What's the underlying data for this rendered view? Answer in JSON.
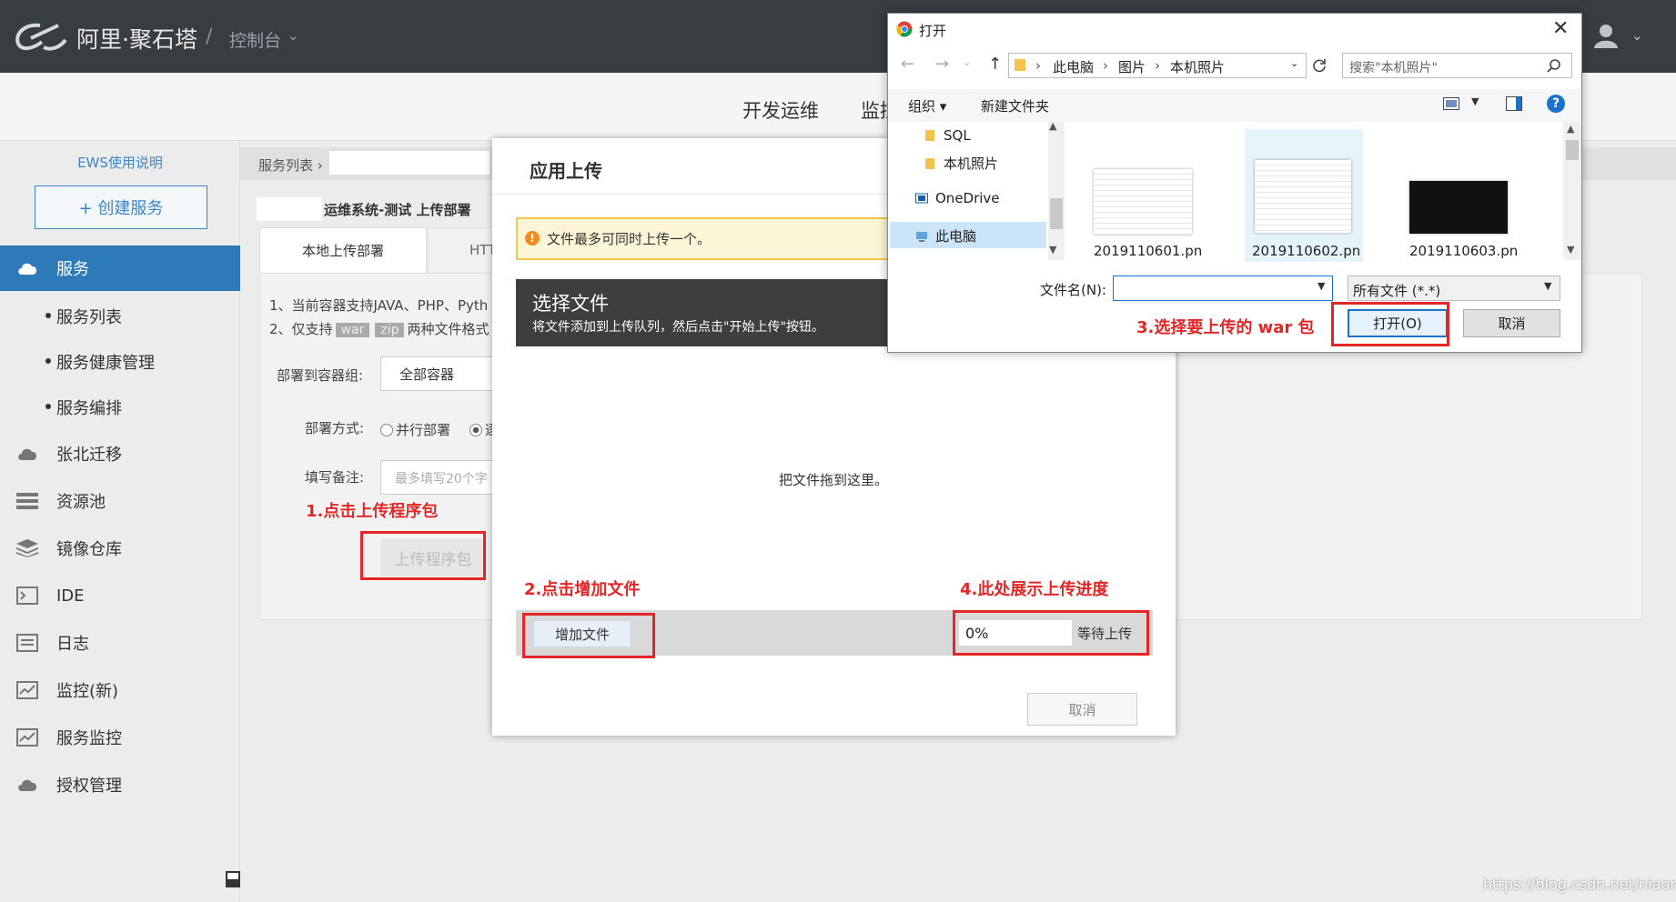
{
  "topbar": {
    "brand": "阿里·聚石塔",
    "separator": "/",
    "console": "控制台",
    "caret": "⌄"
  },
  "subnav": {
    "devops": "开发运维",
    "monitor": "监控"
  },
  "sidebar": {
    "ews_link": "EWS使用说明",
    "create_button": "+ 创建服务",
    "menu": [
      {
        "label": "服务",
        "icon": "cloud-icon",
        "active": true
      },
      {
        "label": "服务列表",
        "sub": true
      },
      {
        "label": "服务健康管理",
        "sub": true
      },
      {
        "label": "服务编排",
        "sub": true
      },
      {
        "label": "张北迁移",
        "icon": "cloud-icon"
      },
      {
        "label": "资源池",
        "icon": "list-icon"
      },
      {
        "label": "镜像仓库",
        "icon": "layers-icon"
      },
      {
        "label": "IDE",
        "icon": "terminal-icon"
      },
      {
        "label": "日志",
        "icon": "log-icon"
      },
      {
        "label": "监控(新)",
        "icon": "monitor-icon"
      },
      {
        "label": "服务监控",
        "icon": "monitor-icon"
      },
      {
        "label": "授权管理",
        "icon": "cloud-icon"
      }
    ]
  },
  "content": {
    "breadcrumb": "服务列表 ›",
    "page_title": "运维系统-测试 上传部署",
    "tabs": [
      "本地上传部署",
      "HTT"
    ],
    "note1": "1、当前容器支持JAVA、PHP、Pyth",
    "note2_prefix": "2、仅支持",
    "note2_tag1": "war",
    "note2_tag2": "zip",
    "note2_suffix": "两种文件格式",
    "group_label": "部署到容器组:",
    "group_value": "全部容器",
    "mode_label": "部署方式:",
    "mode_parallel": "并行部署",
    "mode_serial": "逐",
    "remark_label": "填写备注:",
    "remark_placeholder": "最多填写20个字",
    "upload_button": "上传程序包"
  },
  "annotations": {
    "step1": "1.点击上传程序包",
    "step2": "2.点击增加文件",
    "step3": "3.选择要上传的 war 包",
    "step4": "4.此处展示上传进度"
  },
  "modal": {
    "title": "应用上传",
    "warning": "文件最多可同时上传一个。",
    "choose_title": "选择文件",
    "choose_desc": "将文件添加到上传队列，然后点击\"开始上传\"按钮。",
    "drop_text": "把文件拖到这里。",
    "add_file": "增加文件",
    "progress": "0%",
    "status": "等待上传",
    "cancel": "取消"
  },
  "file_dialog": {
    "title": "打开",
    "close": "✕",
    "path": [
      "此电脑",
      "图片",
      "本机照片"
    ],
    "search_placeholder": "搜索\"本机照片\"",
    "organize": "组织 ▾",
    "new_folder": "新建文件夹",
    "tree": [
      "SQL",
      "本机照片",
      "OneDrive",
      "此电脑"
    ],
    "files": [
      "2019110601.pn",
      "2019110602.pn",
      "2019110603.pn"
    ],
    "filename_label": "文件名(N):",
    "filename_value": "",
    "filetype": "所有文件 (*.*)",
    "open_button": "打开(O)",
    "cancel_button": "取消"
  },
  "watermark": "https://blog.csdn.net/niaonao",
  "colors": {
    "topbar": "#373d41",
    "accent": "#2e7ab8",
    "annotation_red": "#e42626",
    "warning_bg": "#fdf6d6"
  }
}
